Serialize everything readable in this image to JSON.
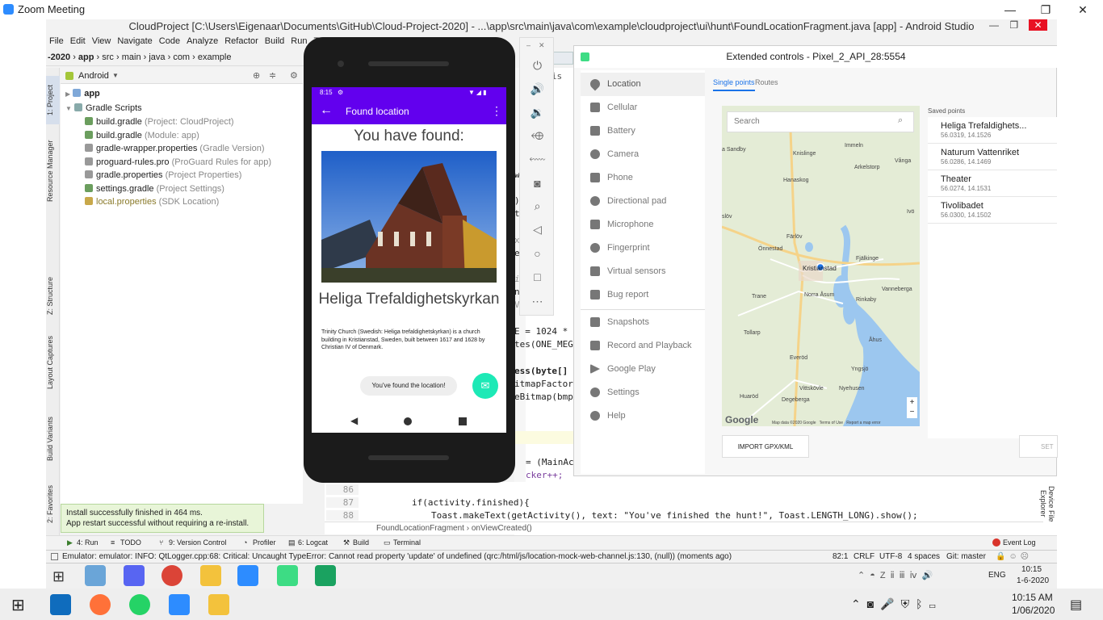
{
  "zoom": {
    "title": "Zoom Meeting",
    "min": "—",
    "max": "❐",
    "close": "✕"
  },
  "as": {
    "title": "CloudProject [C:\\Users\\Eigenaar\\Documents\\GitHub\\Cloud-Project-2020] - ...\\app\\src\\main\\java\\com\\example\\cloudproject\\ui\\hunt\\FoundLocationFragment.java [app] - Android Studio",
    "menu": [
      "File",
      "Edit",
      "View",
      "Navigate",
      "Code",
      "Analyze",
      "Refactor",
      "Build",
      "Run",
      "To"
    ],
    "breadcrumb": [
      "-2020",
      "app",
      "src",
      "main",
      "java",
      "com",
      "example"
    ],
    "project_view": "Android",
    "tree": [
      {
        "name": "app",
        "sub": ""
      },
      {
        "name": "Gradle Scripts",
        "sub": ""
      },
      {
        "name": "build.gradle",
        "sub": "(Project: CloudProject)"
      },
      {
        "name": "build.gradle",
        "sub": "(Module: app)"
      },
      {
        "name": "gradle-wrapper.properties",
        "sub": "(Gradle Version)"
      },
      {
        "name": "proguard-rules.pro",
        "sub": "(ProGuard Rules for app)"
      },
      {
        "name": "gradle.properties",
        "sub": "(Project Properties)"
      },
      {
        "name": "settings.gradle",
        "sub": "(Project Settings)"
      },
      {
        "name": "local.properties",
        "sub": "(SDK Location)"
      }
    ],
    "left_tabs": [
      "1: Project",
      "Resource Manager",
      "Z: Structure",
      "Layout Captures",
      "Build Variants",
      "2: Favorites"
    ],
    "right_tab": "Device File Explorer",
    "code_snips": [
      {
        "text": "ntLis"
      },
      {
        "text": "w, @"
      },
      {
        "text": ") vi"
      },
      {
        "text": "tion"
      },
      {
        "text": "xtVi"
      },
      {
        "text": "etLo"
      },
      {
        "text": "in C"
      },
      {
        "text": "nce"
      },
      {
        "text": "View"
      },
      {
        "text": "E = 1024 * 1"
      },
      {
        "text": "tes(ONE_MEGA"
      },
      {
        "text": "ess(byte[] b"
      },
      {
        "text": "itmapFactory"
      },
      {
        "text": "eBitmap(bmp);"
      },
      {
        "text": "= (MainActiv"
      },
      {
        "text": "cker++;"
      }
    ],
    "line_numbers": [
      "86",
      "87",
      "88"
    ],
    "code_line_87": "if(activity.finished){",
    "code_line_88": "Toast.makeText(getActivity(),  text: \"You've finished the hunt!\", Toast.LENGTH_LONG).show();",
    "editor_breadcrumb": [
      "FoundLocationFragment",
      "onViewCreated()"
    ],
    "toast_line1": "Install successfully finished in 464 ms.",
    "toast_line2": "App restart successful without requiring a re-install.",
    "bottom_tabs": [
      "4: Run",
      "TODO",
      "9: Version Control",
      "Profiler",
      "6: Logcat",
      "Build",
      "Terminal"
    ],
    "event_log": "Event Log",
    "status_msg": "Emulator: emulator: INFO: QtLogger.cpp:68: Critical: Uncaught TypeError: Cannot read property 'update' of undefined (qrc:/html/js/location-mock-web-channel.js:130, (null)) (moments ago)",
    "status_right": [
      "82:1",
      "CRLF",
      "UTF-8",
      "4 spaces",
      "Git: master"
    ]
  },
  "phone": {
    "time": "8:15",
    "appbar_title": "Found location",
    "heading": "You have found:",
    "place_name": "Heliga Trefaldighetskyrkan",
    "description": "Trinity Church (Swedish: Heliga trefaldighetskyrkan) is a church building in Kristianstad, Sweden, built between 1617 and 1628 by Christian IV of Denmark.",
    "snackbar": "You've found the location!",
    "fab_icon": "email-icon",
    "accent": "#6200ee",
    "fab_color": "#1de9b6"
  },
  "ext": {
    "title": "Extended controls - Pixel_2_API_28:5554",
    "sidebar": [
      "Location",
      "Cellular",
      "Battery",
      "Camera",
      "Phone",
      "Directional pad",
      "Microphone",
      "Fingerprint",
      "Virtual sensors",
      "Bug report",
      "Snapshots",
      "Record and Playback",
      "Google Play",
      "Settings",
      "Help"
    ],
    "tabs": [
      "Single points",
      "Routes"
    ],
    "search_placeholder": "Search",
    "saved_title": "Saved points",
    "saved": [
      {
        "name": "Heliga Trefaldighets...",
        "coords": "56.0319, 14.1526"
      },
      {
        "name": "Naturum Vattenriket",
        "coords": "56.0286, 14.1469"
      },
      {
        "name": "Theater",
        "coords": "56.0274, 14.1531"
      },
      {
        "name": "Tivolibadet",
        "coords": "56.0300, 14.1502"
      }
    ],
    "import_btn": "IMPORT GPX/KML",
    "set_btn": "SET L",
    "map_labels": [
      "Knislinge",
      "Immeln",
      "Arkelstorp",
      "Vånga",
      "Hanaskog",
      "Färlöv",
      "Önnestad",
      "Kristianstad",
      "Fjälkinge",
      "Trane",
      "Norra Åsum",
      "Rinkaby",
      "Vanneberga",
      "Tollarp",
      "Åhus",
      "Everöd",
      "Yngsjö",
      "Vittskövle",
      "Nyehusen",
      "Degeberga",
      "Huaröd",
      "a Sandby",
      "slöv",
      "Ivö"
    ],
    "map_google": "Google",
    "map_footer": [
      "Map data ©2020 Google",
      "Terms of Use",
      "Report a map error"
    ]
  },
  "taskbar2": {
    "time": "10:15 AM",
    "date": "1/06/2020"
  },
  "taskbar1": {
    "lang": "ENG",
    "time": "10:15",
    "date": "1-6-2020"
  }
}
